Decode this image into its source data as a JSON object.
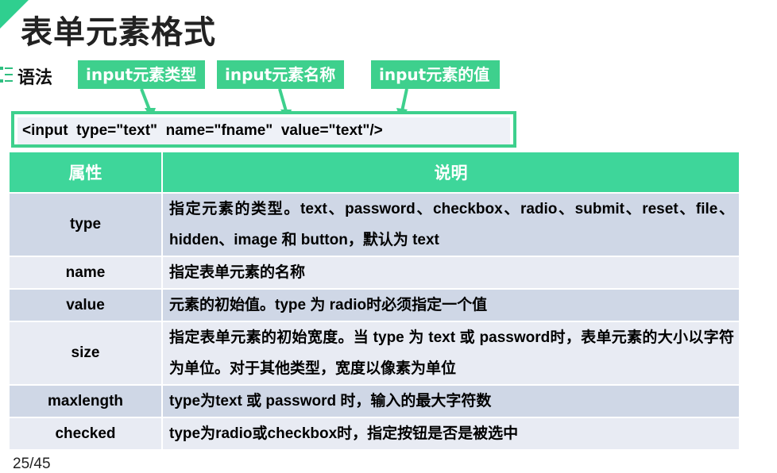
{
  "slide": {
    "title": "表单元素格式",
    "syntax_label": "语法",
    "page_number": "25/45"
  },
  "annotations": [
    {
      "label": "input元素类型"
    },
    {
      "label": "input元素名称"
    },
    {
      "label": "input元素的值"
    }
  ],
  "code": {
    "text": "<input  type=\"text\"  name=\"fname\"  value=\"text\"/>"
  },
  "table": {
    "headers": [
      "属性",
      "说明"
    ],
    "rows": [
      {
        "name": "type",
        "description": "指定元素的类型。text、password、checkbox、radio、submit、reset、file、hidden、image 和 button，默认为 text"
      },
      {
        "name": "name",
        "description": "指定表单元素的名称"
      },
      {
        "name": "value",
        "description": "元素的初始值。type 为 radio时必须指定一个值"
      },
      {
        "name": "size",
        "description": "指定表单元素的初始宽度。当 type 为 text 或 password时，表单元素的大小以字符为单位。对于其他类型，宽度以像素为单位"
      },
      {
        "name": "maxlength",
        "description": "type为text 或 password 时，输入的最大字符数"
      },
      {
        "name": "checked",
        "description": "type为radio或checkbox时，指定按钮是否是被选中"
      }
    ]
  },
  "colors": {
    "accent": "#3ed08d",
    "header_bg": "#3ed69a",
    "row_odd": "#cfd7e6",
    "row_even": "#e8ebf3"
  }
}
